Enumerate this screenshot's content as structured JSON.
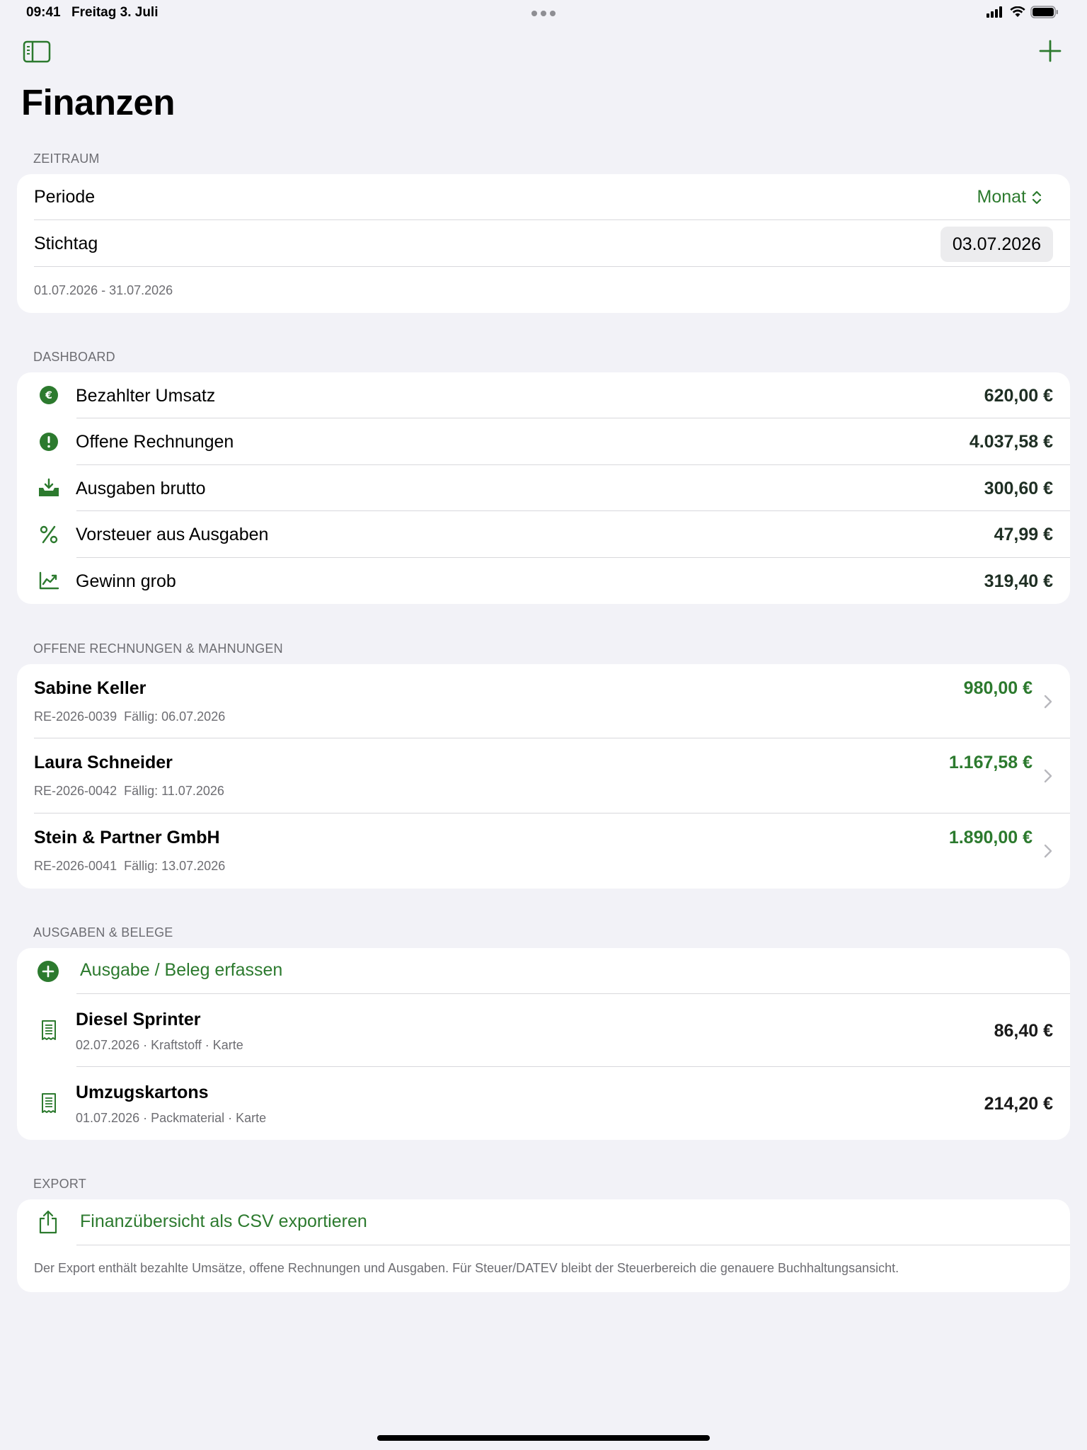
{
  "status_bar": {
    "time": "09:41",
    "date": "Freitag 3. Juli"
  },
  "nav": {
    "sidebar_icon": "sidebar-toggle-icon",
    "add_icon": "plus-icon",
    "title": "Finanzen"
  },
  "colors": {
    "accent": "#2c7a2e",
    "background": "#f2f2f7",
    "card": "#ffffff",
    "secondary_text": "#6d6d72"
  },
  "zeitraum": {
    "header": "ZEITRAUM",
    "periode_label": "Periode",
    "periode_value": "Monat",
    "stichtag_label": "Stichtag",
    "stichtag_value": "03.07.2026",
    "range": "01.07.2026 - 31.07.2026"
  },
  "dashboard": {
    "header": "DASHBOARD",
    "items": [
      {
        "icon": "euro-circle-icon",
        "label": "Bezahlter Umsatz",
        "value": "620,00 €"
      },
      {
        "icon": "exclamation-circle-icon",
        "label": "Offene Rechnungen",
        "value": "4.037,58 €"
      },
      {
        "icon": "tray-download-icon",
        "label": "Ausgaben brutto",
        "value": "300,60 €"
      },
      {
        "icon": "percent-icon",
        "label": "Vorsteuer aus Ausgaben",
        "value": "47,99 €"
      },
      {
        "icon": "chart-line-icon",
        "label": "Gewinn grob",
        "value": "319,40 €"
      }
    ]
  },
  "invoices": {
    "header": "OFFENE RECHNUNGEN & MAHNUNGEN",
    "items": [
      {
        "name": "Sabine Keller",
        "number": "RE-2026-0039",
        "due": "Fällig: 06.07.2026",
        "amount": "980,00 €"
      },
      {
        "name": "Laura Schneider",
        "number": "RE-2026-0042",
        "due": "Fällig: 11.07.2026",
        "amount": "1.167,58 €"
      },
      {
        "name": "Stein & Partner GmbH",
        "number": "RE-2026-0041",
        "due": "Fällig: 13.07.2026",
        "amount": "1.890,00 €"
      }
    ]
  },
  "expenses": {
    "header": "AUSGABEN & BELEGE",
    "add_label": "Ausgabe / Beleg erfassen",
    "items": [
      {
        "name": "Diesel Sprinter",
        "meta": "02.07.2026 · Kraftstoff · Karte",
        "amount": "86,40 €"
      },
      {
        "name": "Umzugskartons",
        "meta": "01.07.2026 · Packmaterial · Karte",
        "amount": "214,20 €"
      }
    ]
  },
  "export": {
    "header": "EXPORT",
    "action_label": "Finanzübersicht als CSV exportieren",
    "note": "Der Export enthält bezahlte Umsätze, offene Rechnungen und Ausgaben. Für Steuer/DATEV bleibt der Steuerbereich die genauere Buchhaltungsansicht."
  }
}
